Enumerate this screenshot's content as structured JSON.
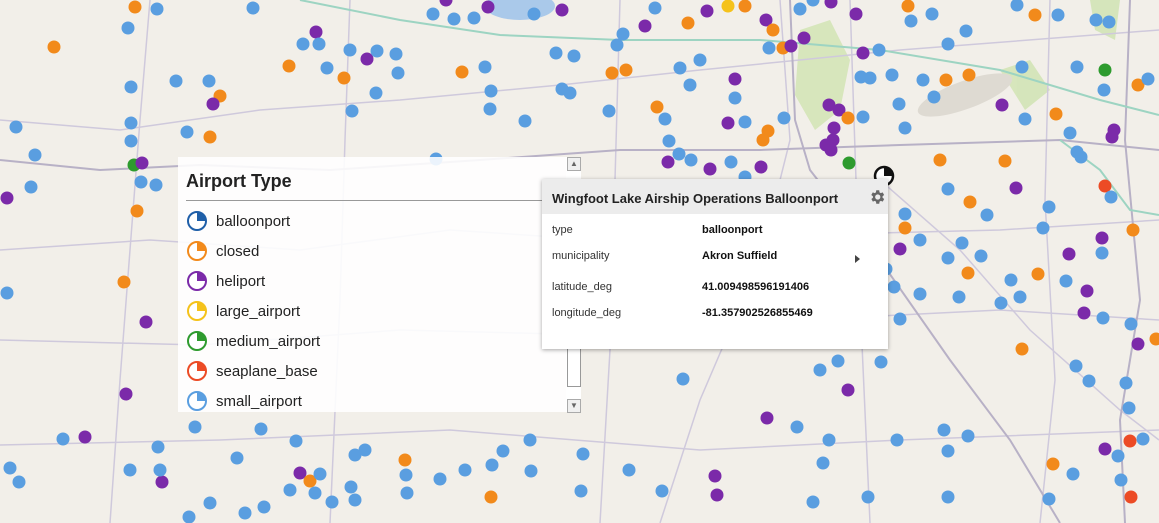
{
  "colors": {
    "ballonport": "#1f5fa8",
    "closed": "#f28a1b",
    "heliport": "#7b2aa9",
    "large_airport": "#f5c21b",
    "medium_airport": "#2e9b2e",
    "seaplane_base": "#ec4b25",
    "small_airport": "#5a9ee0"
  },
  "legend": {
    "title": "Airport Type",
    "items": [
      {
        "label": "balloonport",
        "color": "#1f5fa8"
      },
      {
        "label": "closed",
        "color": "#f28a1b"
      },
      {
        "label": "heliport",
        "color": "#7b2aa9"
      },
      {
        "label": "large_airport",
        "color": "#f5c21b"
      },
      {
        "label": "medium_airport",
        "color": "#2e9b2e"
      },
      {
        "label": "seaplane_base",
        "color": "#ec4b25"
      },
      {
        "label": "small_airport",
        "color": "#5a9ee0"
      }
    ]
  },
  "popup": {
    "title": "Wingfoot Lake Airship Operations Balloonport",
    "rows": [
      {
        "key": "type",
        "value": "balloonport"
      },
      {
        "key": "municipality",
        "value": "Akron Suffield"
      },
      {
        "key": "latitude_deg",
        "value": "41.009498596191406"
      },
      {
        "key": "longitude_deg",
        "value": "-81.357902526855469"
      }
    ]
  }
}
